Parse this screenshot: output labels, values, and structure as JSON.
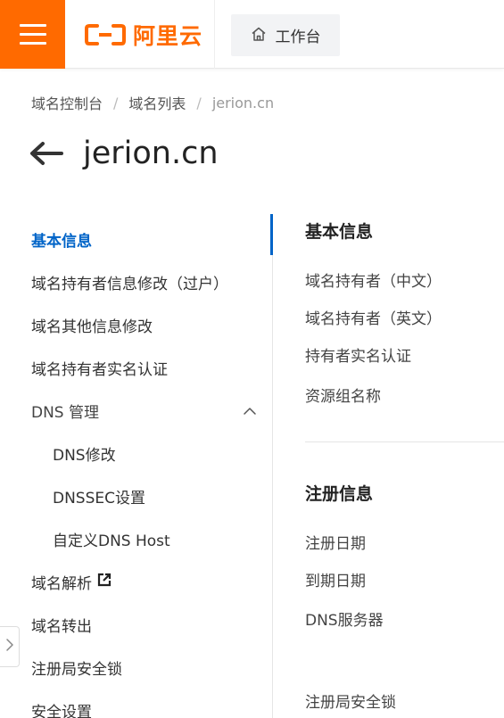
{
  "header": {
    "logo_text": "阿里云",
    "workbench_label": "工作台",
    "brand_color": "#ff6a00"
  },
  "breadcrumb": {
    "items": [
      "域名控制台",
      "域名列表"
    ],
    "current": "jerion.cn",
    "separator": "/"
  },
  "page": {
    "title": "jerion.cn"
  },
  "sidenav": {
    "active_color": "#0064c8",
    "items": [
      {
        "label": "基本信息"
      },
      {
        "label": "域名持有者信息修改（过户）"
      },
      {
        "label": "域名其他信息修改"
      },
      {
        "label": "域名持有者实名认证"
      },
      {
        "label": "DNS 管理"
      },
      {
        "label": "DNS修改"
      },
      {
        "label": "DNSSEC设置"
      },
      {
        "label": "自定义DNS Host"
      },
      {
        "label": "域名解析"
      },
      {
        "label": "域名转出"
      },
      {
        "label": "注册局安全锁"
      },
      {
        "label": "安全设置"
      }
    ]
  },
  "content": {
    "basic_info": {
      "title": "基本信息",
      "fields": [
        "域名持有者（中文）",
        "域名持有者（英文）",
        "持有者实名认证",
        "资源组名称"
      ]
    },
    "registration_info": {
      "title": "注册信息",
      "fields": [
        "注册日期",
        "到期日期",
        "DNS服务器",
        "注册局安全锁"
      ]
    }
  }
}
